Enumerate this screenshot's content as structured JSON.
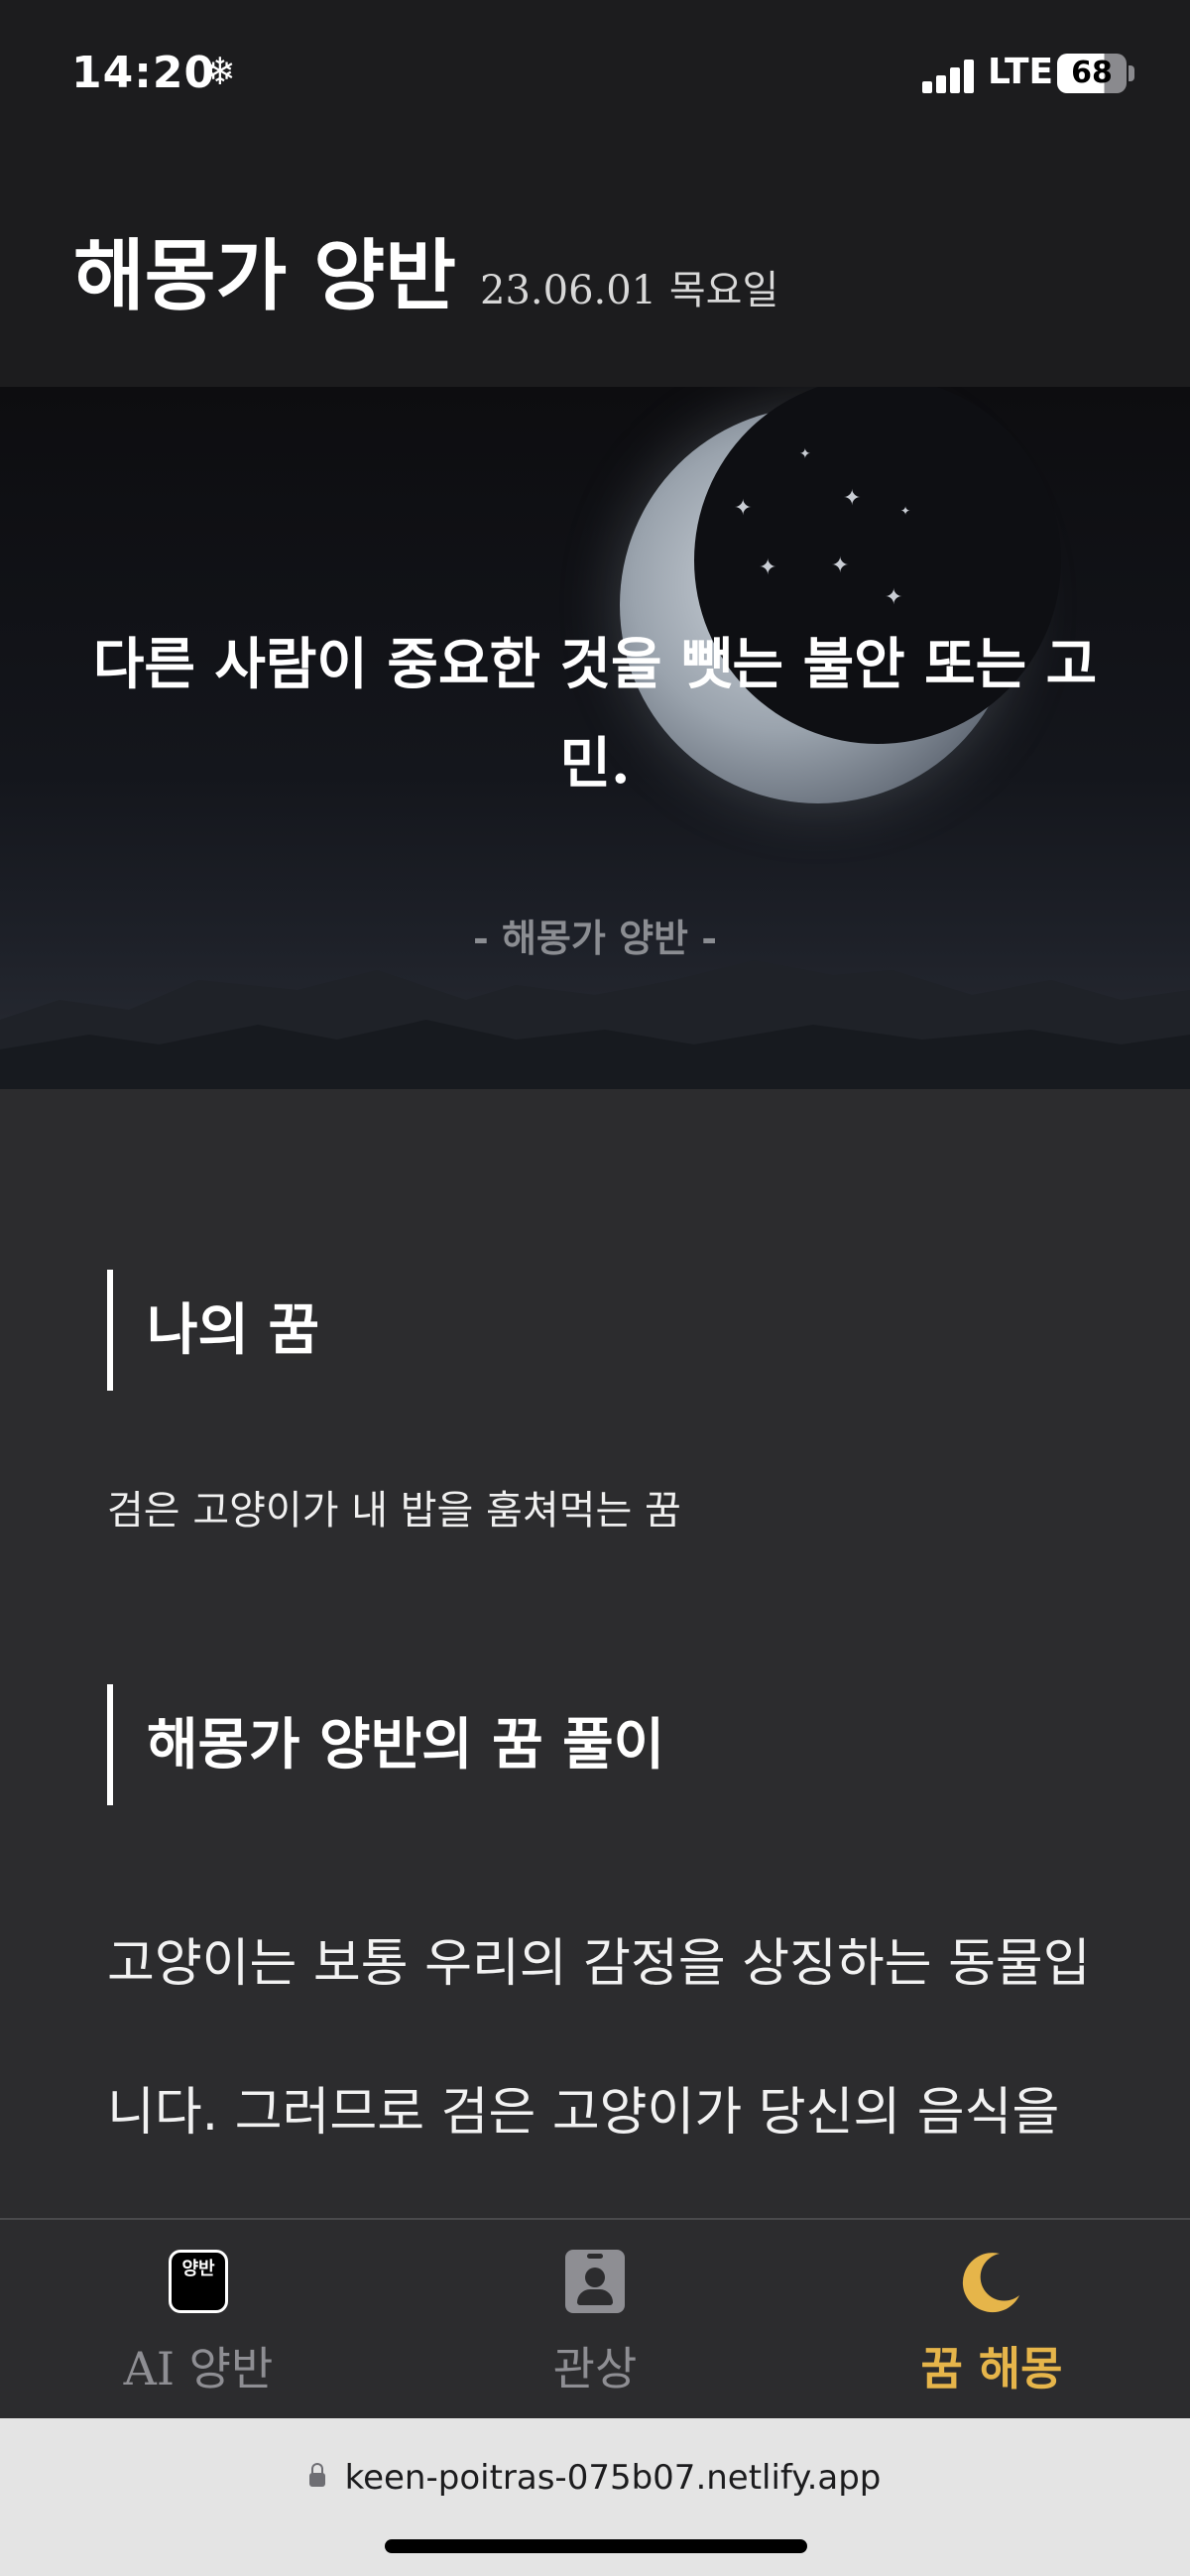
{
  "status_bar": {
    "time": "14:20",
    "network": "LTE",
    "battery": "68"
  },
  "header": {
    "title": "해몽가 양반",
    "date": "23.06.01 목요일"
  },
  "hero": {
    "quote": "다른 사람이 중요한 것을 뺏는 불안 또는 고민.",
    "author": "- 해몽가 양반 -"
  },
  "my_dream": {
    "heading": "나의 꿈",
    "text": "검은 고양이가 내 밥을 훔쳐먹는 꿈"
  },
  "interpretation": {
    "heading": "해몽가 양반의 꿈 풀이",
    "text": "고양이는 보통 우리의 감정을 상징하는 동물입니다. 그러므로 검은 고양이가 당신의 음식을나타내는 것은, 당신이 무언가 유용"
  },
  "nav": {
    "items": [
      {
        "label": "AI 양반",
        "icon": "ai-yangban-icon",
        "active": false
      },
      {
        "label": "관상",
        "icon": "id-badge-icon",
        "active": false
      },
      {
        "label": "꿈 해몽",
        "icon": "moon-icon",
        "active": true
      }
    ],
    "ai_icon_text": "양반"
  },
  "browser": {
    "url": "keen-poitras-075b07.netlify.app"
  },
  "colors": {
    "active": "#e6b54a",
    "inactive": "#8e8e93",
    "background": "#2c2c2e",
    "header_bg": "#1c1c1e"
  }
}
